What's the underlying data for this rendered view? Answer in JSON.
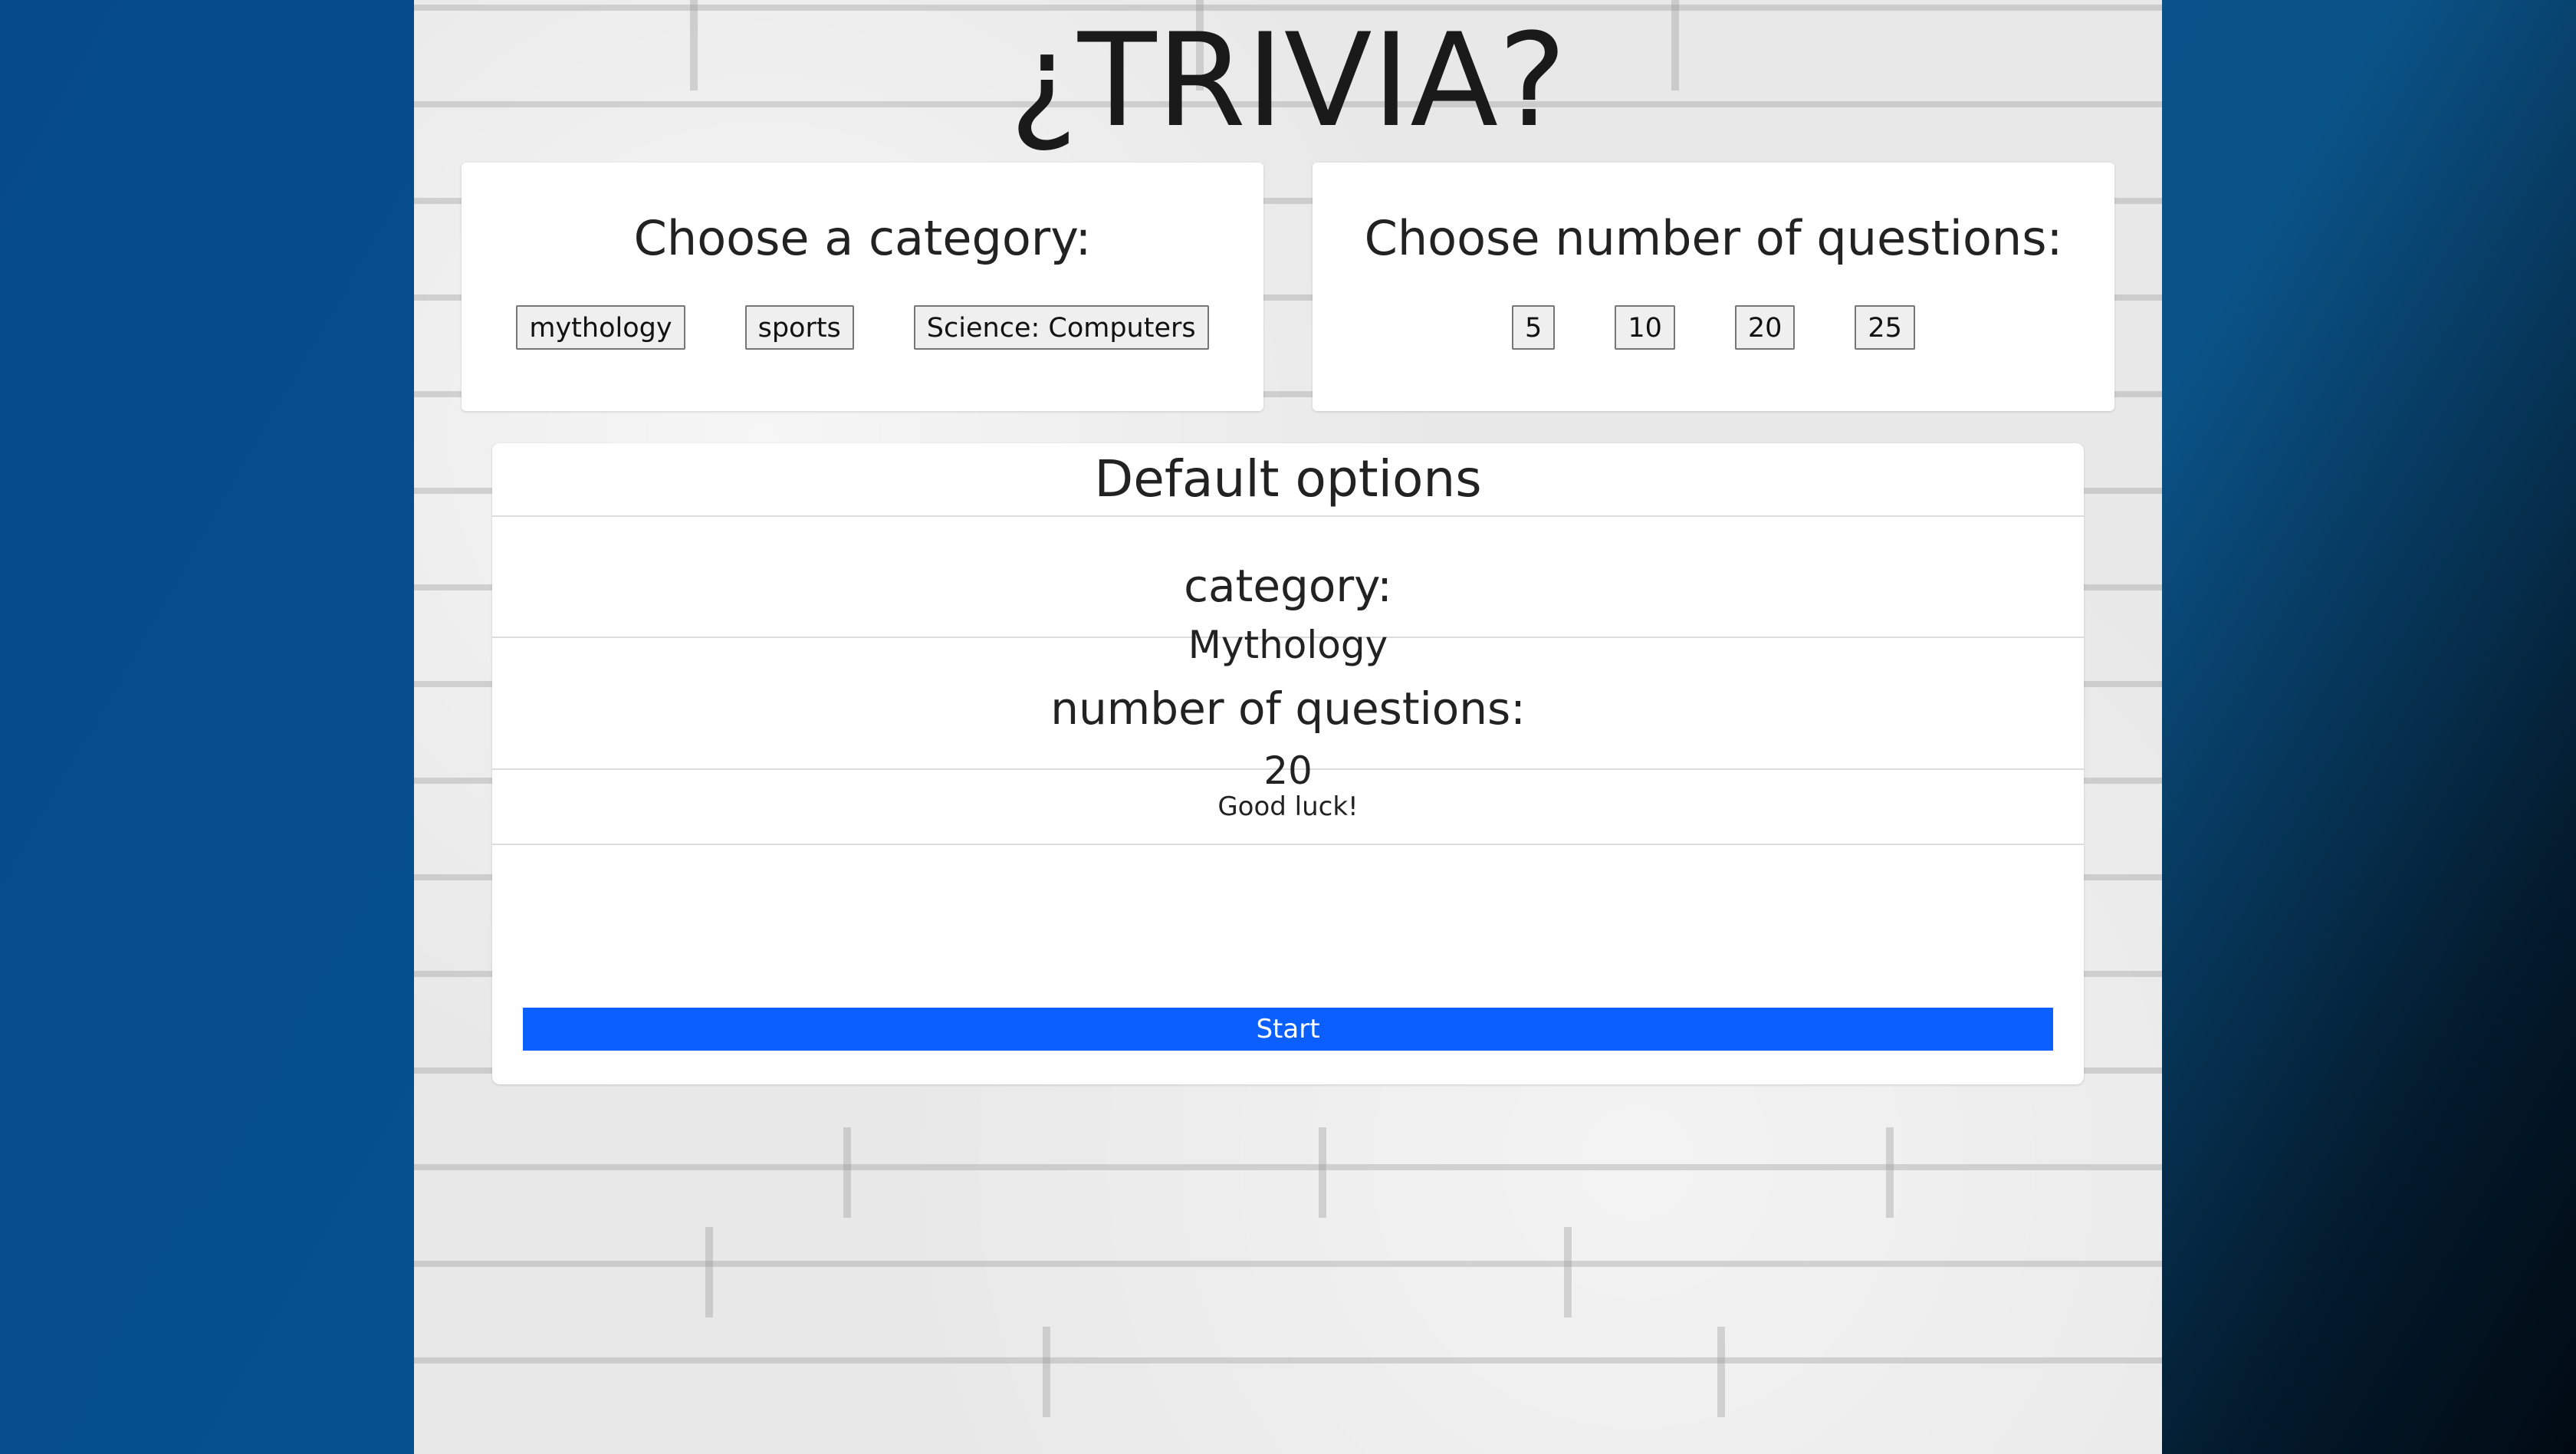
{
  "title": "¿TRIVIA?",
  "category_card": {
    "heading": "Choose a category:",
    "options": [
      "mythology",
      "sports",
      "Science: Computers"
    ]
  },
  "questions_card": {
    "heading": "Choose number of questions:",
    "options": [
      "5",
      "10",
      "20",
      "25"
    ]
  },
  "defaults": {
    "header": "Default options",
    "category_label": "category:",
    "category_value": "Mythology",
    "questions_label": "number of questions:",
    "questions_value": "20",
    "message": "Good luck!",
    "start_label": "Start"
  },
  "colors": {
    "start_button": "#0b5ffe",
    "side_background": "#064a8a"
  }
}
